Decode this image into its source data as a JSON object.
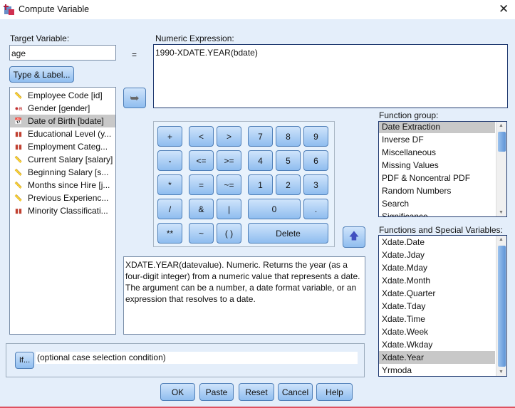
{
  "window": {
    "title": "Compute Variable",
    "close": "✕"
  },
  "target": {
    "label": "Target Variable:",
    "value": "age",
    "type_label_button": "Type & Label..."
  },
  "equals": "=",
  "expression": {
    "label": "Numeric Expression:",
    "value": "1990-XDATE.YEAR(bdate)"
  },
  "variables": [
    {
      "label": "Employee Code [id]",
      "icon": "scale-ruler-icon"
    },
    {
      "label": "Gender [gender]",
      "icon": "nominal-string-icon"
    },
    {
      "label": "Date of Birth [bdate]",
      "icon": "date-scale-icon",
      "selected": true
    },
    {
      "label": "Educational Level (y...",
      "icon": "ordinal-bar-icon"
    },
    {
      "label": "Employment Categ...",
      "icon": "ordinal-bar-icon"
    },
    {
      "label": "Current Salary [salary]",
      "icon": "scale-ruler-icon"
    },
    {
      "label": "Beginning Salary [s...",
      "icon": "scale-ruler-icon"
    },
    {
      "label": "Months since Hire [j...",
      "icon": "scale-ruler-icon"
    },
    {
      "label": "Previous Experienc...",
      "icon": "scale-ruler-icon"
    },
    {
      "label": "Minority Classificati...",
      "icon": "ordinal-bar-icon"
    }
  ],
  "keypad": {
    "plus": "+",
    "lt": "<",
    "gt": ">",
    "k7": "7",
    "k8": "8",
    "k9": "9",
    "minus": "-",
    "le": "<=",
    "ge": ">=",
    "k4": "4",
    "k5": "5",
    "k6": "6",
    "mul": "*",
    "eq": "=",
    "ne": "~=",
    "k1": "1",
    "k2": "2",
    "k3": "3",
    "div": "/",
    "and": "&",
    "or": "|",
    "k0": "0",
    "dot": ".",
    "pow": "**",
    "not": "~",
    "paren": "( )",
    "delete": "Delete"
  },
  "description": "XDATE.YEAR(datevalue). Numeric. Returns the year (as a four-digit integer) from a numeric value that represents a date. The argument can be a number, a date format variable, or an expression that resolves to a date.",
  "function_group": {
    "label": "Function group:",
    "items": [
      "Date Extraction",
      "Inverse DF",
      "Miscellaneous",
      "Missing Values",
      "PDF & Noncentral PDF",
      "Random Numbers",
      "Search",
      "Significance"
    ],
    "selected": "Date Extraction"
  },
  "functions": {
    "label": "Functions and Special Variables:",
    "items": [
      "Xdate.Date",
      "Xdate.Jday",
      "Xdate.Mday",
      "Xdate.Month",
      "Xdate.Quarter",
      "Xdate.Tday",
      "Xdate.Time",
      "Xdate.Week",
      "Xdate.Wkday",
      "Xdate.Year",
      "Yrmoda"
    ],
    "selected": "Xdate.Year"
  },
  "if": {
    "button": "If...",
    "condition": "(optional case selection condition)"
  },
  "buttons": {
    "ok": "OK",
    "paste": "Paste",
    "reset": "Reset",
    "cancel": "Cancel",
    "help": "Help"
  },
  "colors": {
    "background": "#e4eefa",
    "button": "#8fbdef",
    "selection": "#c8c8c8",
    "bottom_line": "#e05060"
  }
}
